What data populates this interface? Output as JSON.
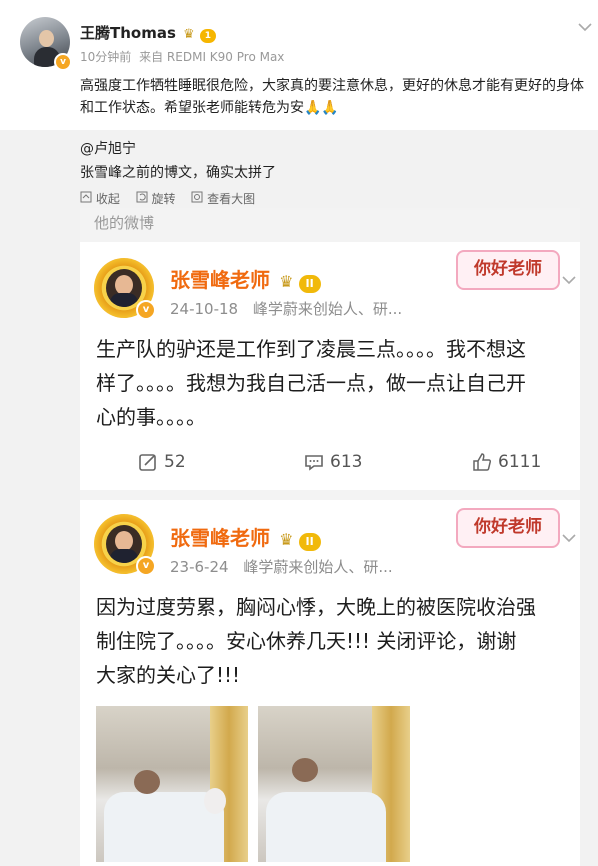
{
  "post": {
    "username": "王腾Thomas",
    "level": "1",
    "time": "10分钟前",
    "source": "来自 REDMI K90 Pro Max",
    "text_line1": "高强度工作牺牲睡眠很危险，大家真的要注意休息，更好的休息才能有更好的身体",
    "text_line2": "和工作状态。希望张老师能转危为安🙏🙏"
  },
  "repost": {
    "mention": "@卢旭宁",
    "comment": "张雪峰之前的博文，确实太拼了",
    "actions": [
      "收起",
      "旋转",
      "查看大图"
    ]
  },
  "screenshot": {
    "header": "他的微博",
    "posts": [
      {
        "name": "张雪峰老师",
        "level": "II",
        "date": "24-10-18",
        "bio": "峰学蔚来创始人、研...",
        "sticker": "你好老师",
        "text": [
          "生产队的驴还是工作到了凌晨三点。。。。我不想这",
          "样了。。。。我想为我自己活一点，做一点让自己开",
          "心的事。。。。"
        ],
        "reposts": "52",
        "comments": "613",
        "likes": "6111"
      },
      {
        "name": "张雪峰老师",
        "level": "II",
        "date": "23-6-24",
        "bio": "峰学蔚来创始人、研...",
        "sticker": "你好老师",
        "text": [
          "因为过度劳累，胸闷心悸，大晚上的被医院收治强",
          "制住院了。。。。安心休养几天!!! 关闭评论，谢谢",
          "大家的关心了!!!"
        ]
      }
    ]
  },
  "colors": {
    "accent_orange": "#f06a0f",
    "level_gold": "#f1b90a",
    "band_gray": "#f2f2f2"
  }
}
